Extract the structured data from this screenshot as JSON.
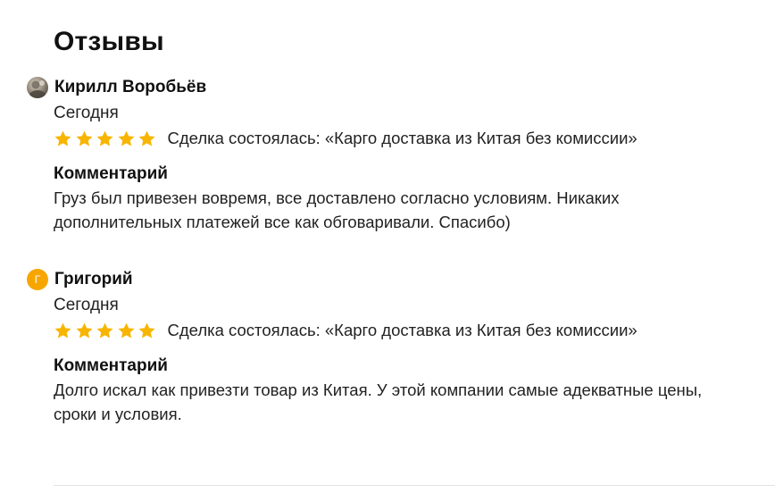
{
  "page": {
    "title": "Отзывы"
  },
  "colors": {
    "star": "#f7b500",
    "avatar_letter_bg": "#f7a600"
  },
  "reviews": [
    {
      "author": "Кирилл Воробьёв",
      "avatar": {
        "type": "photo",
        "icon": "user-photo"
      },
      "date": "Сегодня",
      "rating": 5,
      "deal": "Сделка состоялась: «Карго доставка из Китая без комиссии»",
      "comment_label": "Комментарий",
      "comment": "Груз был привезен вовремя, все доставлено согласно условиям. Никаких дополнительных платежей все как обговаривали. Спасибо)"
    },
    {
      "author": "Григорий",
      "avatar": {
        "type": "letter",
        "letter": "Г"
      },
      "date": "Сегодня",
      "rating": 5,
      "deal": "Сделка состоялась: «Карго доставка из Китая без комиссии»",
      "comment_label": "Комментарий",
      "comment": "Долго искал как привезти товар из Китая. У этой компании самые адекватные цены, сроки и условия."
    }
  ]
}
